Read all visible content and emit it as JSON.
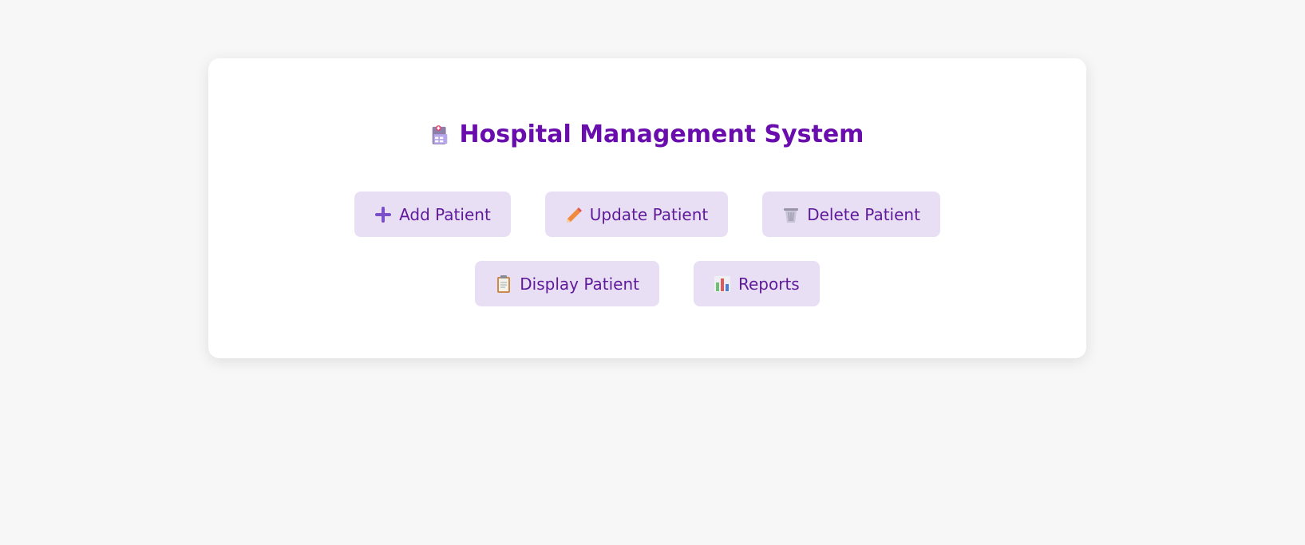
{
  "header": {
    "title": "Hospital Management System",
    "title_icon": "hospital-icon",
    "title_color": "#6a0dad"
  },
  "buttons": [
    {
      "label": "Add Patient",
      "icon": "plus-icon"
    },
    {
      "label": "Update Patient",
      "icon": "pencil-icon"
    },
    {
      "label": "Delete Patient",
      "icon": "wastebasket-icon"
    },
    {
      "label": "Display Patient",
      "icon": "clipboard-icon"
    },
    {
      "label": "Reports",
      "icon": "bar-chart-icon"
    }
  ],
  "colors": {
    "button_bg": "#e9dff4",
    "button_text": "#5e1a9b",
    "page_bg": "#f7f7f7",
    "card_bg": "#ffffff"
  }
}
